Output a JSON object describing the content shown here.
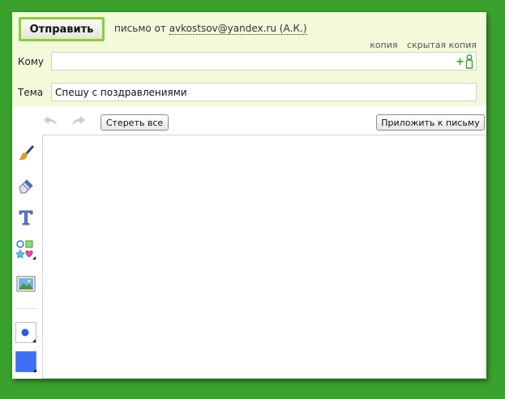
{
  "header": {
    "send_label": "Отправить",
    "from_prefix": "письмо от",
    "from_address": "avkostsov@yandex.ru (А.К.)",
    "cc_label": "копия",
    "bcc_label": "скрытая копия"
  },
  "fields": {
    "to_label": "Кому",
    "to_value": "",
    "subject_label": "Тема",
    "subject_value": "Спешу с поздравлениями"
  },
  "toolbar": {
    "clear_label": "Стереть все",
    "attach_label": "Приложить к письму"
  },
  "tools": {
    "icons": [
      "brush-icon",
      "eraser-icon",
      "text-icon",
      "shapes-icon",
      "image-icon",
      "pen-size-icon",
      "color-swatch-icon"
    ],
    "current_color": "#3d6ef5"
  },
  "colors": {
    "background": "#3aa12e",
    "header_bg": "#f2fad9",
    "send_border": "#8ccd3c"
  }
}
